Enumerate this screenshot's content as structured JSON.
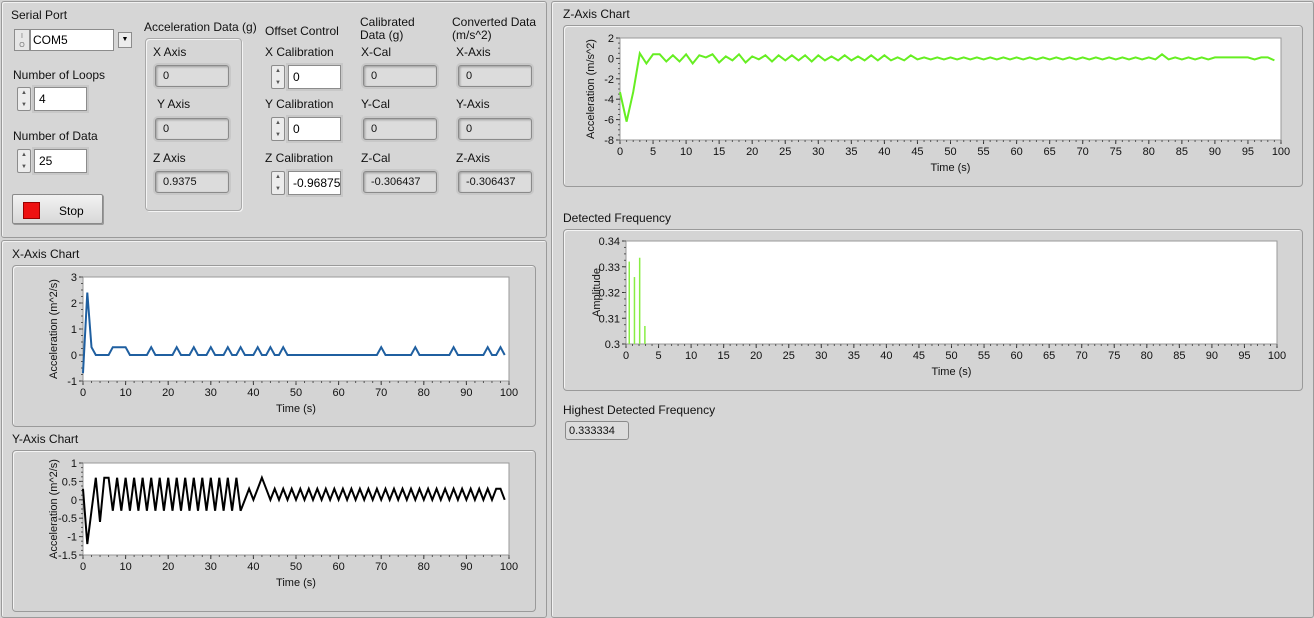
{
  "serial_port": {
    "label": "Serial Port",
    "prefix_icon": "visa-io-icon",
    "value": "COM5"
  },
  "loops": {
    "label": "Number of Loops",
    "value": "4"
  },
  "data_count": {
    "label": "Number of Data",
    "value": "25"
  },
  "stop_button": {
    "label": "Stop",
    "led_color": "#ee1111"
  },
  "acceleration": {
    "title": "Acceleration Data (g)",
    "x_label": "X Axis",
    "x_value": "0",
    "y_label": "Y Axis",
    "y_value": "0",
    "z_label": "Z Axis",
    "z_value": "0.9375"
  },
  "offset": {
    "title": "Offset Control",
    "x_label": "X Calibration",
    "x_value": "0",
    "y_label": "Y Calibration",
    "y_value": "0",
    "z_label": "Z Calibration",
    "z_value": "-0.96875"
  },
  "calibrated": {
    "title": "Calibrated Data (g)",
    "x_label": "X-Cal",
    "x_value": "0",
    "y_label": "Y-Cal",
    "y_value": "0",
    "z_label": "Z-Cal",
    "z_value": "-0.306437"
  },
  "converted": {
    "title": "Converted Data (m/s^2)",
    "x_label": "X-Axis",
    "x_value": "0",
    "y_label": "Y-Axis",
    "y_value": "0",
    "z_label": "Z-Axis",
    "z_value": "-0.306437"
  },
  "highest_frequency": {
    "label": "Highest Detected Frequency",
    "value": "0.333334"
  },
  "chart_data": [
    {
      "id": "x",
      "type": "line",
      "title": "X-Axis Chart",
      "xlabel": "Time (s)",
      "ylabel": "Acceleration (m^2/s)",
      "xlim": [
        0,
        100
      ],
      "ylim": [
        -1,
        3
      ],
      "xticks": [
        0,
        10,
        20,
        30,
        40,
        50,
        60,
        70,
        80,
        90,
        100
      ],
      "yticks": [
        -1,
        0,
        1,
        2,
        3
      ],
      "color": "#1f5fa0",
      "x": [
        0,
        1,
        2,
        3,
        4,
        5,
        6,
        7,
        8,
        9,
        10,
        11,
        12,
        13,
        14,
        15,
        16,
        17,
        18,
        19,
        20,
        21,
        22,
        23,
        24,
        25,
        26,
        27,
        28,
        29,
        30,
        31,
        32,
        33,
        34,
        35,
        36,
        37,
        38,
        39,
        40,
        41,
        42,
        43,
        44,
        45,
        46,
        47,
        48,
        49,
        50,
        51,
        52,
        53,
        54,
        55,
        56,
        57,
        58,
        59,
        60,
        61,
        62,
        63,
        64,
        65,
        66,
        67,
        68,
        69,
        70,
        71,
        72,
        73,
        74,
        75,
        76,
        77,
        78,
        79,
        80,
        81,
        82,
        83,
        84,
        85,
        86,
        87,
        88,
        89,
        90,
        91,
        92,
        93,
        94,
        95,
        96,
        97,
        98,
        99
      ],
      "y": [
        -0.7,
        2.4,
        0.3,
        0,
        0,
        0,
        0,
        0.3,
        0.3,
        0.3,
        0.3,
        0,
        0,
        0,
        0,
        0,
        0.3,
        0,
        0,
        0,
        0,
        0,
        0.3,
        0,
        0,
        0,
        0.3,
        0,
        0,
        0,
        0.3,
        0,
        0,
        0,
        0.3,
        0,
        0,
        0.3,
        0,
        0,
        0,
        0.3,
        0,
        0,
        0.3,
        0,
        0,
        0.3,
        0,
        0,
        0,
        0,
        0,
        0,
        0,
        0,
        0,
        0,
        0,
        0,
        0,
        0,
        0,
        0,
        0,
        0,
        0,
        0,
        0,
        0,
        0.3,
        0,
        0,
        0,
        0,
        0,
        0,
        0,
        0.3,
        0,
        0,
        0,
        0,
        0,
        0,
        0,
        0,
        0.3,
        0,
        0,
        0,
        0,
        0,
        0,
        0,
        0.3,
        0,
        0,
        0.3,
        0
      ]
    },
    {
      "id": "y",
      "type": "line",
      "title": "Y-Axis Chart",
      "xlabel": "Time (s)",
      "ylabel": "Acceleration (m^2/s)",
      "xlim": [
        0,
        100
      ],
      "ylim": [
        -1.5,
        1
      ],
      "xticks": [
        0,
        10,
        20,
        30,
        40,
        50,
        60,
        70,
        80,
        90,
        100
      ],
      "yticks": [
        -1.5,
        -1,
        -0.5,
        0,
        0.5,
        1
      ],
      "color": "#000000",
      "x": [
        0,
        1,
        2,
        3,
        4,
        5,
        6,
        7,
        8,
        9,
        10,
        11,
        12,
        13,
        14,
        15,
        16,
        17,
        18,
        19,
        20,
        21,
        22,
        23,
        24,
        25,
        26,
        27,
        28,
        29,
        30,
        31,
        32,
        33,
        34,
        35,
        36,
        37,
        38,
        39,
        40,
        41,
        42,
        43,
        44,
        45,
        46,
        47,
        48,
        49,
        50,
        51,
        52,
        53,
        54,
        55,
        56,
        57,
        58,
        59,
        60,
        61,
        62,
        63,
        64,
        65,
        66,
        67,
        68,
        69,
        70,
        71,
        72,
        73,
        74,
        75,
        76,
        77,
        78,
        79,
        80,
        81,
        82,
        83,
        84,
        85,
        86,
        87,
        88,
        89,
        90,
        91,
        92,
        93,
        94,
        95,
        96,
        97,
        98,
        99
      ],
      "y": [
        0.3,
        -1.2,
        -0.3,
        0.6,
        -0.6,
        0.6,
        0.6,
        -0.3,
        0.6,
        -0.3,
        0.6,
        -0.3,
        0.6,
        -0.3,
        0.6,
        -0.3,
        0.6,
        -0.3,
        0.6,
        -0.3,
        0.6,
        -0.3,
        0.6,
        -0.3,
        0.6,
        -0.3,
        0.6,
        -0.3,
        0.6,
        -0.3,
        0.6,
        -0.3,
        0.6,
        -0.3,
        0.6,
        -0.3,
        0.6,
        -0.3,
        0,
        0.3,
        0,
        0.3,
        0.6,
        0.3,
        0,
        0.3,
        0,
        0.3,
        0,
        0.3,
        0,
        0.3,
        0,
        0.3,
        0,
        0.3,
        0,
        0.3,
        0,
        0.3,
        0,
        0.3,
        0,
        0.3,
        0,
        0.3,
        0,
        0.3,
        0,
        0.3,
        0,
        0.3,
        0,
        0.3,
        0,
        0.3,
        0,
        0.3,
        0,
        0.3,
        0,
        0.3,
        0,
        0.3,
        0,
        0.3,
        0,
        0.3,
        0,
        0.3,
        0,
        0.3,
        0,
        0.3,
        0,
        0.3,
        0,
        0.3,
        0.3,
        0
      ]
    },
    {
      "id": "z",
      "type": "line",
      "title": "Z-Axis Chart",
      "xlabel": "Time (s)",
      "ylabel": "Acceleration (m/s^2)",
      "xlim": [
        0,
        100
      ],
      "ylim": [
        -8,
        2
      ],
      "xticks": [
        0,
        5,
        10,
        15,
        20,
        25,
        30,
        35,
        40,
        45,
        50,
        55,
        60,
        65,
        70,
        75,
        80,
        85,
        90,
        95,
        100
      ],
      "yticks": [
        -8,
        -6,
        -4,
        -2,
        0,
        2
      ],
      "color": "#66ee22",
      "x": [
        0,
        1,
        2,
        3,
        4,
        5,
        6,
        7,
        8,
        9,
        10,
        11,
        12,
        13,
        14,
        15,
        16,
        17,
        18,
        19,
        20,
        21,
        22,
        23,
        24,
        25,
        26,
        27,
        28,
        29,
        30,
        31,
        32,
        33,
        34,
        35,
        36,
        37,
        38,
        39,
        40,
        41,
        42,
        43,
        44,
        45,
        46,
        47,
        48,
        49,
        50,
        51,
        52,
        53,
        54,
        55,
        56,
        57,
        58,
        59,
        60,
        61,
        62,
        63,
        64,
        65,
        66,
        67,
        68,
        69,
        70,
        71,
        72,
        73,
        74,
        75,
        76,
        77,
        78,
        79,
        80,
        81,
        82,
        83,
        84,
        85,
        86,
        87,
        88,
        89,
        90,
        91,
        92,
        93,
        94,
        95,
        96,
        97,
        98,
        99
      ],
      "y": [
        -3.3,
        -6.2,
        -3.3,
        0.5,
        -0.5,
        0.4,
        0.4,
        -0.3,
        0.3,
        -0.3,
        0.4,
        -0.5,
        0.3,
        0.1,
        0.4,
        -0.4,
        0.2,
        -0.2,
        0.4,
        -0.4,
        0.2,
        -0.1,
        0.3,
        -0.3,
        0.3,
        -0.2,
        0.3,
        -0.2,
        0.3,
        -0.3,
        0.3,
        -0.2,
        0.2,
        -0.2,
        0.3,
        -0.2,
        0.2,
        -0.2,
        0.3,
        -0.2,
        0.3,
        -0.2,
        0.1,
        -0.2,
        0.3,
        -0.1,
        0.1,
        -0.1,
        0.1,
        -0.1,
        0.1,
        -0.1,
        0.1,
        -0.1,
        0.1,
        -0.1,
        0.1,
        -0.1,
        0.1,
        -0.1,
        0.1,
        -0.1,
        0.1,
        -0.1,
        0.1,
        -0.1,
        0.1,
        -0.1,
        0.1,
        -0.1,
        0.1,
        -0.1,
        0.1,
        -0.1,
        0.1,
        -0.1,
        0.1,
        -0.1,
        0.1,
        -0.1,
        0.1,
        -0.1,
        0.4,
        -0.1,
        0.1,
        -0.1,
        0.1,
        -0.1,
        0.1,
        -0.1,
        0.1,
        0.1,
        0.1,
        0.1,
        0.1,
        0.1,
        -0.1,
        0.1,
        0.1,
        -0.2
      ]
    },
    {
      "id": "freq",
      "type": "bar",
      "title": "Detected Frequency",
      "xlabel": "Time (s)",
      "ylabel": "Amplitude",
      "xlim": [
        0,
        100
      ],
      "ylim": [
        0.3,
        0.34
      ],
      "xticks": [
        0,
        5,
        10,
        15,
        20,
        25,
        30,
        35,
        40,
        45,
        50,
        55,
        60,
        65,
        70,
        75,
        80,
        85,
        90,
        95,
        100
      ],
      "yticks": [
        0.3,
        0.31,
        0.32,
        0.33,
        0.34
      ],
      "color": "#88ee44",
      "x": [
        0.5,
        1.3,
        2.1,
        2.9
      ],
      "y": [
        0.332,
        0.326,
        0.3335,
        0.307
      ]
    }
  ]
}
